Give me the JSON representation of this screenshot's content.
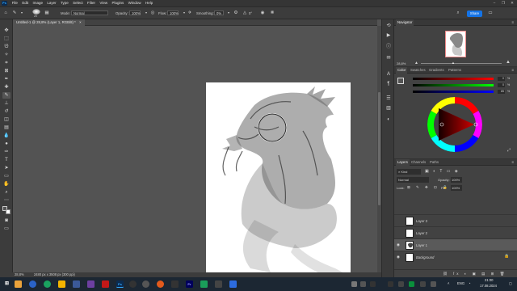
{
  "app": {
    "logo_text": "Ps"
  },
  "menu": [
    "File",
    "Edit",
    "Image",
    "Layer",
    "Type",
    "Select",
    "Filter",
    "View",
    "Plugins",
    "Window",
    "Help"
  ],
  "window_controls": [
    "–",
    "❐",
    "✕"
  ],
  "options": {
    "brush_size": "20",
    "mode_label": "Mode:",
    "mode_value": "Normal",
    "opacity_label": "Opacity:",
    "opacity_value": "100%",
    "flow_label": "Flow:",
    "flow_value": "100%",
    "smoothing_label": "Smoothing:",
    "smoothing_value": "0%",
    "angle_value": "0°",
    "share_label": "Share"
  },
  "document_tab": {
    "title": "Untitled-1 @ 28,8% (Layer 1, RGB/8) *",
    "close": "×"
  },
  "status": {
    "zoom": "28,8%",
    "doc_info": "2480 px x 3508 px (300 ppi)"
  },
  "navigator": {
    "tab": "Navigator",
    "zoom": "28,8%"
  },
  "color_panel": {
    "tabs": [
      "Color",
      "Swatches",
      "Gradients",
      "Patterns"
    ],
    "foreground": "#535353",
    "background": "#ffffff",
    "r_value": "0",
    "g_value": "0",
    "b_value": "85"
  },
  "layers_panel": {
    "tabs": [
      "Layers",
      "Channels",
      "Paths"
    ],
    "kind_label": "Kind",
    "blend_mode": "Normal",
    "opacity_label": "Opacity:",
    "opacity_value": "100%",
    "lock_label": "Lock:",
    "fill_label": "Fill:",
    "fill_value": "100%",
    "layers": [
      {
        "name": "Layer 3"
      },
      {
        "name": "Layer 2"
      },
      {
        "name": "Layer 1"
      },
      {
        "name": "Background"
      }
    ]
  },
  "taskbar": {
    "apps": [
      "Ps",
      "Pr",
      "Ai"
    ],
    "lang": "ENG",
    "time": "21:00",
    "date": "17.08.2024"
  },
  "colors": {
    "accent": "#1473e6",
    "ps_blue": "#31a8ff",
    "canvas": "#ffffff",
    "workspace": "#535353"
  }
}
